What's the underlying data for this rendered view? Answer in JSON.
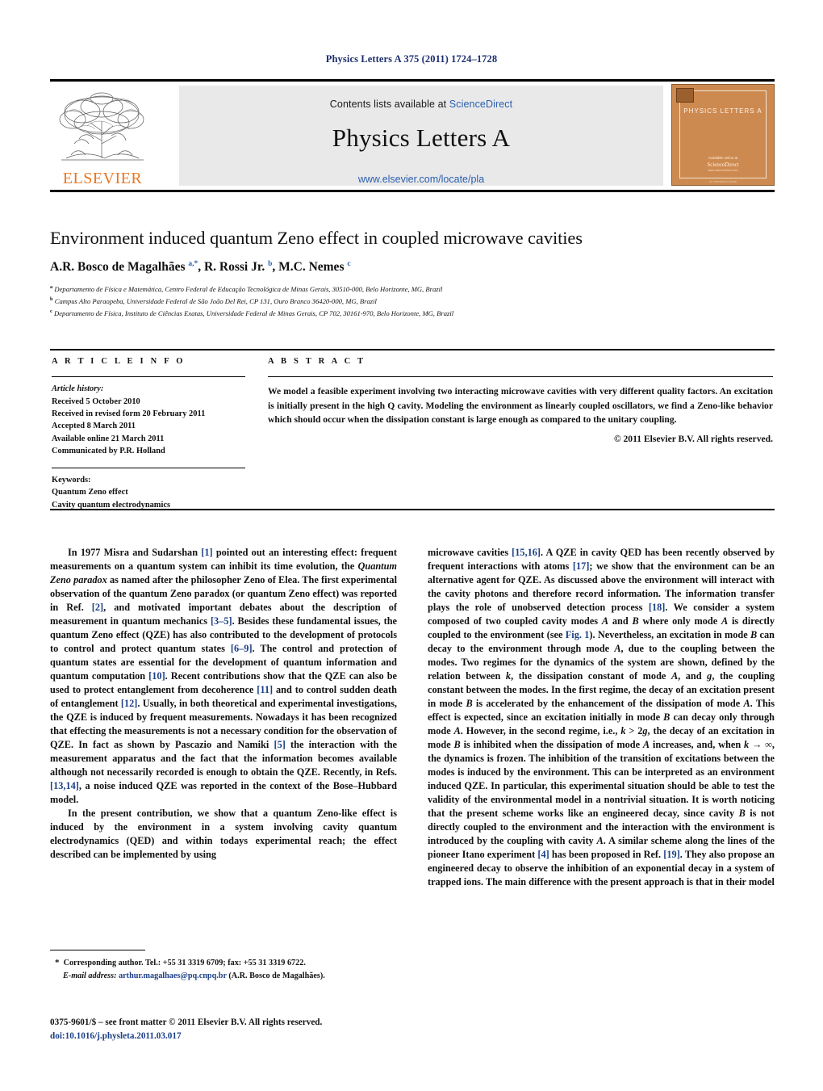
{
  "running_head": "Physics Letters A 375 (2011) 1724–1728",
  "masthead": {
    "contents_prefix": "Contents lists available at ",
    "sciencedirect": "ScienceDirect",
    "journal_title": "Physics Letters A",
    "journal_url": "www.elsevier.com/locate/pla",
    "publisher_wordmark": "ELSEVIER",
    "cover": {
      "title": "PHYSICS LETTERS A",
      "foot1": "Available online at",
      "foot2": "ScienceDirect",
      "foot3": "www.sciencedirect.com",
      "bottom_bar": "An International Journal"
    }
  },
  "article": {
    "title": "Environment induced quantum Zeno effect in coupled microwave cavities",
    "authors_html": "A.R. Bosco de Magalhães <sup>a,*</sup>, R. Rossi Jr. <sup>b</sup>, M.C. Nemes <sup>c</sup>",
    "affiliations": [
      {
        "marker": "a",
        "text": "Departamento de Física e Matemática, Centro Federal de Educação Tecnológica de Minas Gerais, 30510-000, Belo Horizonte, MG, Brazil"
      },
      {
        "marker": "b",
        "text": "Campus Alto Paraopeba, Universidade Federal de São João Del Rei, CP 131, Ouro Branco 36420-000, MG, Brazil"
      },
      {
        "marker": "c",
        "text": "Departamento de Física, Instituto de Ciências Exatas, Universidade Federal de Minas Gerais, CP 702, 30161-970, Belo Horizonte, MG, Brazil"
      }
    ]
  },
  "info": {
    "heading": "A R T I C L E   I N F O",
    "history_label": "Article history:",
    "history": [
      "Received 5 October 2010",
      "Received in revised form 20 February 2011",
      "Accepted 8 March 2011",
      "Available online 21 March 2011",
      "Communicated by P.R. Holland"
    ],
    "keywords_label": "Keywords:",
    "keywords": [
      "Quantum Zeno effect",
      "Cavity quantum electrodynamics"
    ]
  },
  "abstract": {
    "heading": "A B S T R A C T",
    "text": "We model a feasible experiment involving two interacting microwave cavities with very different quality factors. An excitation is initially present in the high Q cavity. Modeling the environment as linearly coupled oscillators, we find a Zeno-like behavior which should occur when the dissipation constant is large enough as compared to the unitary coupling.",
    "copyright": "© 2011 Elsevier B.V. All rights reserved."
  },
  "body": {
    "left_paragraphs_html": [
      "In 1977 Misra and Sudarshan <span class=\"ref\">[1]</span> pointed out an interesting effect: frequent measurements on a quantum system can inhibit its time evolution, the <span class=\"it\">Quantum Zeno paradox</span> as named after the philosopher Zeno of Elea. The first experimental observation of the quantum Zeno paradox (or quantum Zeno effect) was reported in Ref. <span class=\"ref\">[2]</span>, and motivated important debates about the description of measurement in quantum mechanics <span class=\"ref\">[3–5]</span>. Besides these fundamental issues, the quantum Zeno effect (QZE) has also contributed to the development of protocols to control and protect quantum states <span class=\"ref\">[6–9]</span>. The control and protection of quantum states are essential for the development of quantum information and quantum computation <span class=\"ref\">[10]</span>. Recent contributions show that the QZE can also be used to protect entanglement from decoherence <span class=\"ref\">[11]</span> and to control sudden death of entanglement <span class=\"ref\">[12]</span>. Usually, in both theoretical and experimental investigations, the QZE is induced by frequent measurements. Nowadays it has been recognized that effecting the measurements is not a necessary condition for the observation of QZE. In fact as shown by Pascazio and Namiki <span class=\"ref\">[5]</span> the interaction with the measurement apparatus and the fact that the information becomes available although not necessarily recorded is enough to obtain the QZE. Recently, in Refs. <span class=\"ref\">[13,14]</span>, a noise induced QZE was reported in the context of the Bose–Hubbard model.",
      "In the present contribution, we show that a quantum Zeno-like effect is induced by the environment in a system involving cavity quantum electrodynamics (QED) and within todays experimental reach; the effect described can be implemented by using"
    ],
    "right_paragraphs_html": [
      "microwave cavities <span class=\"ref\">[15,16]</span>. A QZE in cavity QED has been recently observed by frequent interactions with atoms <span class=\"ref\">[17]</span>; we show that the environment can be an alternative agent for QZE. As discussed above the environment will interact with the cavity photons and therefore record information. The information transfer plays the role of unobserved detection process <span class=\"ref\">[18]</span>. We consider a system composed of two coupled cavity modes <span class=\"it\">A</span> and <span class=\"it\">B</span> where only mode <span class=\"it\">A</span> is directly coupled to the environment (see <span class=\"ref\">Fig. 1</span>). Nevertheless, an excitation in mode <span class=\"it\">B</span> can decay to the environment through mode <span class=\"it\">A</span>, due to the coupling between the modes. Two regimes for the dynamics of the system are shown, defined by the relation between <span class=\"it\">k</span>, the dissipation constant of mode <span class=\"it\">A</span>, and <span class=\"it\">g</span>, the coupling constant between the modes. In the first regime, the decay of an excitation present in mode <span class=\"it\">B</span> is accelerated by the enhancement of the dissipation of mode <span class=\"it\">A</span>. This effect is expected, since an excitation initially in mode <span class=\"it\">B</span> can decay only through mode <span class=\"it\">A</span>. However, in the second regime, i.e., <span class=\"it\">k</span> &gt; 2<span class=\"it\">g</span>, the decay of an excitation in mode <span class=\"it\">B</span> is inhibited when the dissipation of mode <span class=\"it\">A</span> increases, and, when <span class=\"it\">k</span> → ∞, the dynamics is frozen. The inhibition of the transition of excitations between the modes is induced by the environment. This can be interpreted as an environment induced QZE. In particular, this experimental situation should be able to test the validity of the environmental model in a nontrivial situation. It is worth noticing that the present scheme works like an engineered decay, since cavity <span class=\"it\">B</span> is not directly coupled to the environment and the interaction with the environment is introduced by the coupling with cavity <span class=\"it\">A</span>. A similar scheme along the lines of the pioneer Itano experiment <span class=\"ref\">[4]</span> has been proposed in Ref. <span class=\"ref\">[19]</span>. They also propose an engineered decay to observe the inhibition of an exponential decay in a system of trapped ions. The main difference with the present approach is that in their model"
    ]
  },
  "footnotes": {
    "corresponding": "Corresponding author. Tel.: +55 31 3319 6709; fax: +55 31 3319 6722.",
    "email_label": "E-mail address:",
    "email": "arthur.magalhaes@pq.cnpq.br",
    "email_owner": "(A.R. Bosco de Magalhães).",
    "issn_line": "0375-9601/$ – see front matter  © 2011 Elsevier B.V. All rights reserved.",
    "doi_line": "doi:10.1016/j.physleta.2011.03.017"
  },
  "colors": {
    "link_blue": "#2b5fb0",
    "ref_blue": "#1b3f86",
    "head_blue": "#1b2e6e",
    "elsevier_orange": "#e87722",
    "cover_tan": "#cd8a50",
    "banner_gray": "#e9e9e9"
  }
}
